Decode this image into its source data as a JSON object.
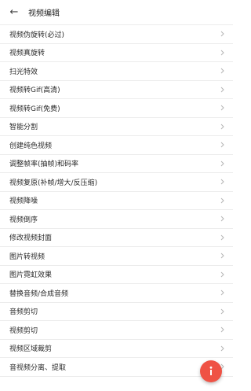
{
  "colors": {
    "fab_background": "#ef5245",
    "divider": "#ececec",
    "text": "#2a2a2a"
  },
  "header": {
    "back_icon": "arrow-left-icon",
    "back_glyph": "←",
    "title": "视频编辑"
  },
  "menu": {
    "chevron_icon": "chevron-right-icon",
    "items": [
      "视频伪旋转(必过)",
      "视频真旋转",
      "扫光特效",
      "视频转Gif(高清)",
      "视频转Gif(免费)",
      "智能分割",
      "创建纯色视频",
      "调整帧率(抽帧)和码率",
      "视频复原(补帧/增大/反压缩)",
      "视频降噪",
      "视频倒序",
      "修改视频封面",
      "图片转视频",
      "图片霓虹效果",
      "替换音频/合成音频",
      "音频剪切",
      "视频剪切",
      "视频区域裁剪",
      "音视频分离、提取"
    ]
  },
  "fab": {
    "icon": "info-icon",
    "glyph": "i"
  }
}
